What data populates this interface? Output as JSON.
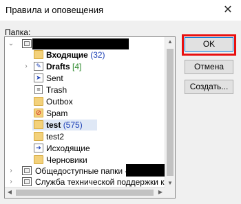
{
  "window": {
    "title": "Правила и оповещения",
    "close_label": "✕"
  },
  "folder_label": "Папка:",
  "tree": {
    "items": [
      {
        "label": "Входящие",
        "count": "(32)",
        "count_style": "blue",
        "bold": true,
        "icon": "inbox-folder-icon"
      },
      {
        "label": "Drafts",
        "count": "[4]",
        "count_style": "green",
        "bold": true,
        "icon": "drafts-icon"
      },
      {
        "label": "Sent",
        "count": "",
        "bold": false,
        "icon": "sent-icon"
      },
      {
        "label": "Trash",
        "count": "",
        "bold": false,
        "icon": "trash-icon"
      },
      {
        "label": "Outbox",
        "count": "",
        "bold": false,
        "icon": "outbox-folder-icon"
      },
      {
        "label": "Spam",
        "count": "",
        "bold": false,
        "icon": "spam-icon"
      },
      {
        "label": "test",
        "count": "(575)",
        "count_style": "blue",
        "bold": true,
        "icon": "folder-icon",
        "selected": true
      },
      {
        "label": "test2",
        "count": "",
        "bold": false,
        "icon": "folder-icon"
      },
      {
        "label": "Исходящие",
        "count": "",
        "bold": false,
        "icon": "outbox-icon"
      },
      {
        "label": "Черновики",
        "count": "",
        "bold": false,
        "icon": "folder-icon"
      }
    ],
    "public_folders": "Общедоступные папки -",
    "support_service": "Служба технической поддержки кс"
  },
  "buttons": {
    "ok": "OK",
    "cancel": "Отмена",
    "create": "Создать..."
  }
}
